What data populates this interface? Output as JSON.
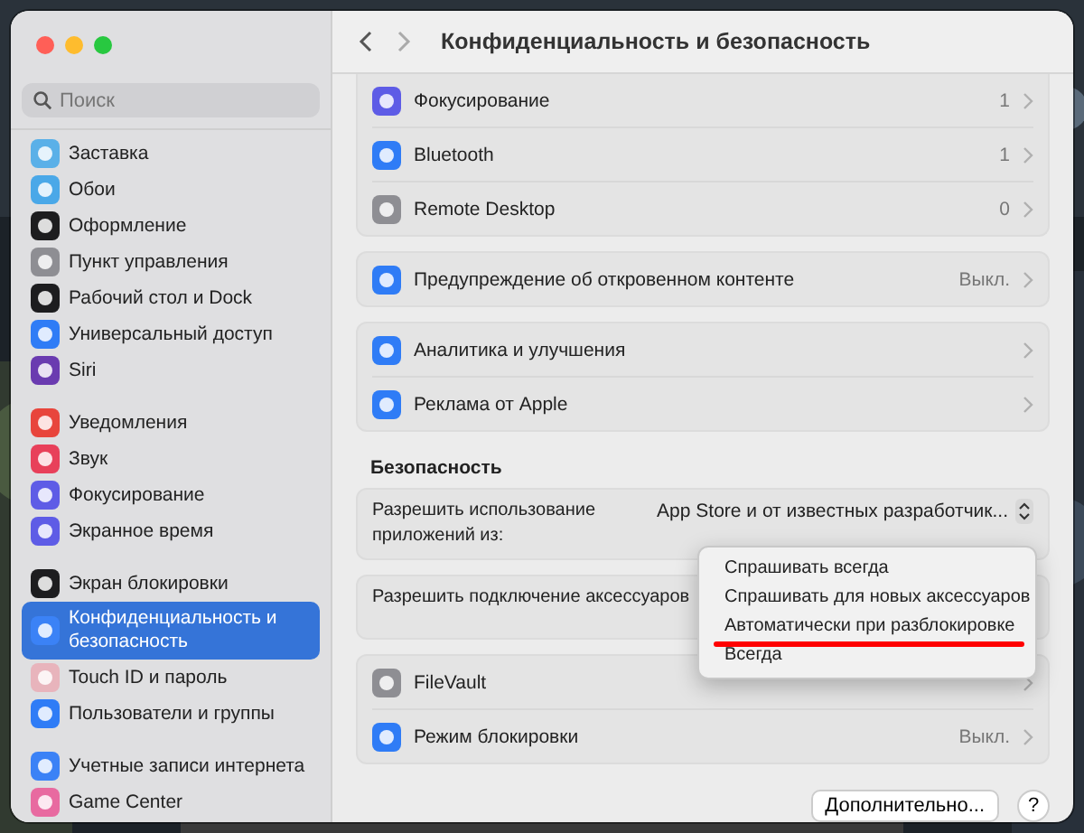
{
  "sidebar": {
    "search": {
      "placeholder": "Поиск"
    },
    "groups": [
      [
        {
          "label": "Заставка",
          "color": "#5ab0e8",
          "selected": false
        },
        {
          "label": "Обои",
          "color": "#4aa8e8",
          "selected": false
        },
        {
          "label": "Оформление",
          "color": "#1d1d1f",
          "selected": false
        },
        {
          "label": "Пункт управления",
          "color": "#8e8e93",
          "selected": false
        },
        {
          "label": "Рабочий стол и Dock",
          "color": "#1d1d1f",
          "selected": false
        },
        {
          "label": "Универсальный доступ",
          "color": "#2f7cf6",
          "selected": false
        },
        {
          "label": "Siri",
          "color": "#6a3bb0",
          "selected": false
        }
      ],
      [
        {
          "label": "Уведомления",
          "color": "#e8453c",
          "selected": false
        },
        {
          "label": "Звук",
          "color": "#e8405a",
          "selected": false
        },
        {
          "label": "Фокусирование",
          "color": "#5e5ce6",
          "selected": false
        },
        {
          "label": "Экранное время",
          "color": "#5e5ce6",
          "selected": false
        }
      ],
      [
        {
          "label": "Экран блокировки",
          "color": "#1d1d1f",
          "selected": false
        },
        {
          "label": "Конфиденциальность и безопасность",
          "color": "#3b82f6",
          "selected": true
        },
        {
          "label": "Touch ID и пароль",
          "color": "#e8b4bc",
          "selected": false
        },
        {
          "label": "Пользователи и группы",
          "color": "#2f7cf6",
          "selected": false
        }
      ],
      [
        {
          "label": "Учетные записи интернета",
          "color": "#3b82f6",
          "selected": false
        },
        {
          "label": "Game Center",
          "color": "#e86aa0",
          "selected": false
        }
      ]
    ]
  },
  "toolbar": {
    "title": "Конфиденциальность и безопасность"
  },
  "groups": [
    {
      "rows": [
        {
          "kind": "link",
          "label": "Фокусирование",
          "value": "1",
          "color": "#5e5ce6"
        },
        {
          "kind": "link",
          "label": "Bluetooth",
          "value": "1",
          "color": "#2f7cf6"
        },
        {
          "kind": "link",
          "label": "Remote Desktop",
          "value": "0",
          "color": "#8e8e93"
        }
      ]
    },
    {
      "rows": [
        {
          "kind": "link",
          "label": "Предупреждение об откровенном контенте",
          "value": "Выкл.",
          "color": "#2f7cf6"
        }
      ]
    },
    {
      "rows": [
        {
          "kind": "link",
          "label": "Аналитика и улучшения",
          "color": "#2f7cf6"
        },
        {
          "kind": "link",
          "label": "Реклама от Apple",
          "color": "#2f7cf6"
        }
      ]
    },
    {
      "heading": "Безопасность",
      "rows": [
        {
          "kind": "popup",
          "label": "Разрешить использование приложений из:",
          "value": "App Store и от известных разработчик..."
        }
      ]
    },
    {
      "rows": [
        {
          "kind": "popup",
          "label": "Разрешить подключение аксессуаров"
        }
      ]
    },
    {
      "rows": [
        {
          "kind": "link",
          "label": "FileVault",
          "color": "#8e8e93"
        },
        {
          "kind": "link",
          "label": "Режим блокировки",
          "value": "Выкл.",
          "color": "#2f7cf6"
        }
      ]
    }
  ],
  "menu": {
    "items": [
      {
        "label": "Спрашивать всегда",
        "underlined": false
      },
      {
        "label": "Спрашивать для новых аксессуаров",
        "underlined": false
      },
      {
        "label": "Автоматически при разблокировке",
        "underlined": true
      },
      {
        "label": "Всегда",
        "underlined": false
      }
    ]
  },
  "footer": {
    "button": "Дополнительно...",
    "help": "?"
  }
}
